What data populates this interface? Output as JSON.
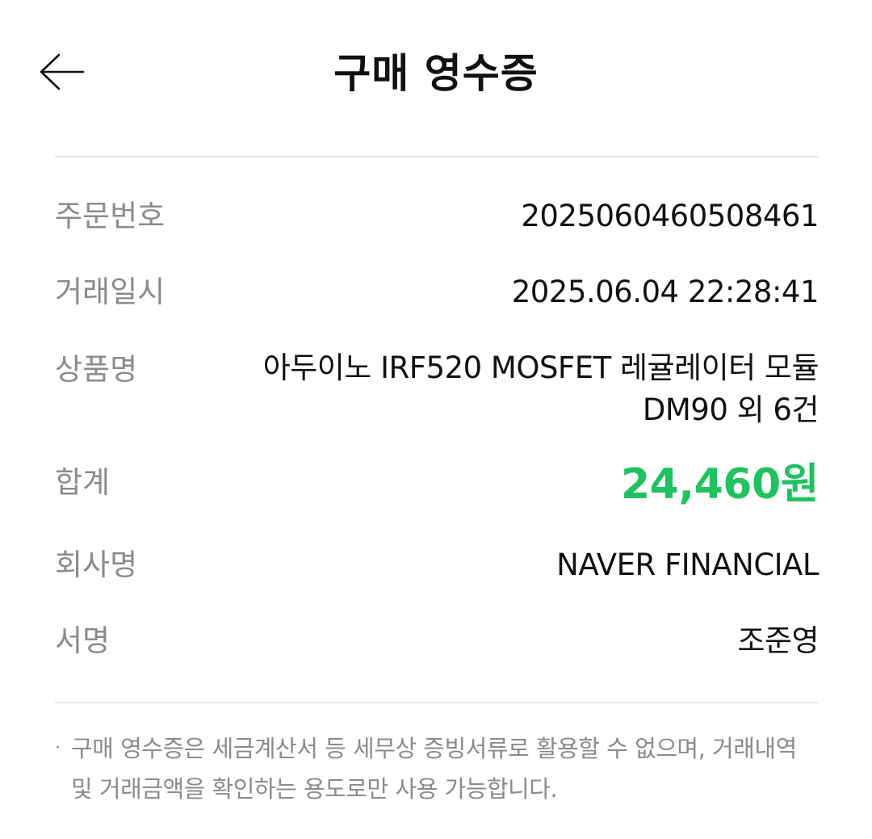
{
  "header": {
    "title": "구매 영수증",
    "back_icon": "arrow-left-icon"
  },
  "receipt": {
    "order_number": {
      "label": "주문번호",
      "value": "2025060460508461"
    },
    "transaction_date": {
      "label": "거래일시",
      "value": "2025.06.04 22:28:41"
    },
    "product_name": {
      "label": "상품명",
      "value": "아두이노 IRF520 MOSFET 레귤레이터 모듈 DM90 외 6건"
    },
    "total": {
      "label": "합계",
      "value": "24,460원"
    },
    "company": {
      "label": "회사명",
      "value": "NAVER FINANCIAL"
    },
    "signature": {
      "label": "서명",
      "value": "조준영"
    }
  },
  "notice": {
    "bullet": "·",
    "text": "구매 영수증은 세금계산서 등 세무상 증빙서류로 활용할 수 없으며, 거래내역 및 거래금액을 확인하는 용도로만 사용 가능합니다."
  },
  "colors": {
    "accent_total": "#1ec35f",
    "label_gray": "#8b8b8b",
    "divider": "#e4e4e4",
    "text": "#111111"
  }
}
